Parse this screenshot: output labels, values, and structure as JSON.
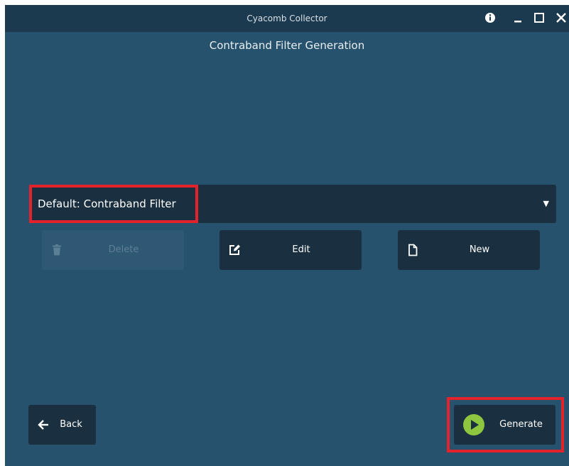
{
  "window": {
    "title": "Cyacomb Collector",
    "controls": [
      "info-icon",
      "minimize-icon",
      "maximize-icon",
      "close-icon"
    ]
  },
  "page": {
    "title": "Contraband Filter Generation"
  },
  "filter_select": {
    "value": "Default: Contraband Filter"
  },
  "actions": {
    "delete_label": "Delete",
    "edit_label": "Edit",
    "new_label": "New"
  },
  "footer": {
    "back_label": "Back",
    "generate_label": "Generate"
  },
  "colors": {
    "background": "#27526e",
    "titlebar": "#1c3a4f",
    "button": "#1a3040",
    "highlight": "#e3222b",
    "accent": "#8ec63f"
  }
}
